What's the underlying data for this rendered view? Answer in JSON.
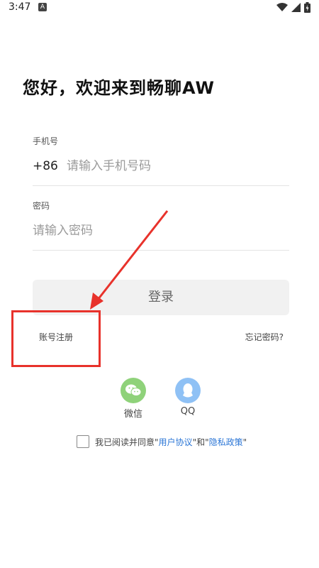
{
  "status_bar": {
    "time": "3:47",
    "notif_icon": "A",
    "icons": [
      "wifi-icon",
      "signal-icon",
      "battery-icon"
    ]
  },
  "welcome_title": "您好，欢迎来到畅聊AW",
  "phone": {
    "label": "手机号",
    "country_code": "+86",
    "placeholder": "请输入手机号码",
    "value": ""
  },
  "password": {
    "label": "密码",
    "placeholder": "请输入密码",
    "value": ""
  },
  "login_button": "登录",
  "register_link": "账号注册",
  "forgot_link": "忘记密码?",
  "social": {
    "wechat_label": "微信",
    "qq_label": "QQ"
  },
  "agreement": {
    "checked": false,
    "prefix": "我已阅读并同意",
    "quote_open": "\"",
    "user_agreement": "用户协议",
    "quote_close": "\"",
    "and": "和",
    "privacy_policy": "隐私政策"
  },
  "annotation_color": "#e8322b",
  "accent_link_color": "#2b76d6"
}
